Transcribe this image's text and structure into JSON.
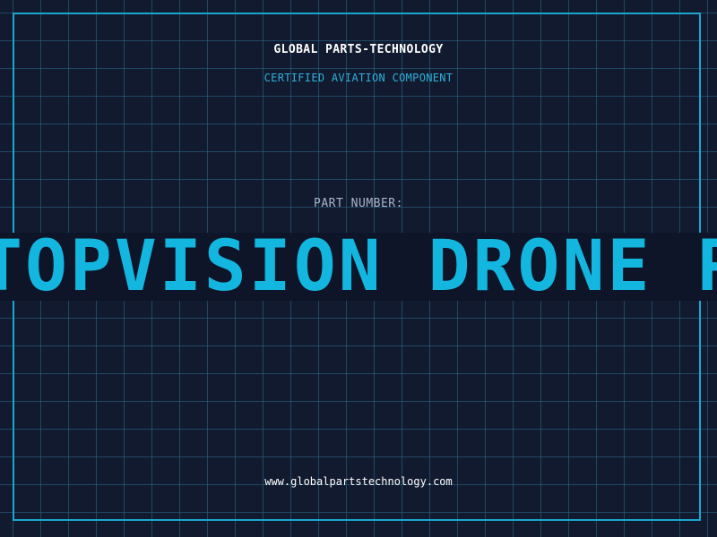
{
  "header": {
    "company": "GLOBAL PARTS-TECHNOLOGY",
    "tagline": "CERTIFIED AVIATION COMPONENT"
  },
  "part": {
    "label": "PART NUMBER:",
    "name": "TOPVISION DRONE PARTS"
  },
  "footer": {
    "url": "www.globalpartstechnology.com"
  },
  "colors": {
    "background": "#121a30",
    "accent": "#13b6df",
    "grid": "#2c6e8a",
    "text": "#ffffff",
    "muted": "#a9b3c6"
  }
}
